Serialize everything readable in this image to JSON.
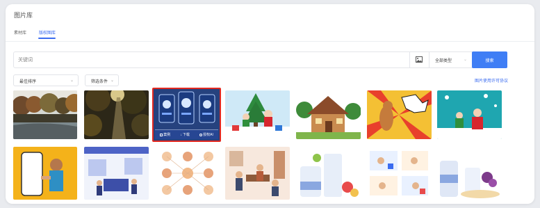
{
  "window": {
    "title": "图片库"
  },
  "tabs": [
    {
      "label": "素材库",
      "active": false
    },
    {
      "label": "版权图库",
      "active": true
    }
  ],
  "search": {
    "placeholder": "关键词",
    "image_search_icon": "image-icon",
    "type_select": {
      "value": "全部类型"
    },
    "button_label": "搜索"
  },
  "filters": {
    "sort": {
      "value": "最佳排序"
    },
    "filter": {
      "value": "筛选条件"
    },
    "agreement_link": "图片使用许可协议"
  },
  "selected_overlay": {
    "buttons": [
      {
        "label": "案例",
        "icon": "square-icon"
      },
      {
        "label": "下载",
        "icon": "download-icon"
      },
      {
        "label": "授权AI",
        "icon": "circle-icon"
      }
    ]
  },
  "gallery": {
    "row1": [
      {
        "subject": "autumn forest lake",
        "icon": "photo-icon"
      },
      {
        "subject": "sunlit forest road",
        "icon": "photo-icon"
      },
      {
        "subject": "three phone mockups",
        "icon": "photo-icon",
        "selected": true
      },
      {
        "subject": "christmas tree with santa and elf",
        "icon": "illustration-icon"
      },
      {
        "subject": "cartoon cabin in the woods",
        "icon": "illustration-icon"
      },
      {
        "subject": "comic bang kangaroo",
        "icon": "illustration-icon"
      },
      {
        "subject": "santa and elf in snow",
        "icon": "illustration-icon"
      }
    ],
    "row2": [
      {
        "subject": "woman holding phone mockup",
        "icon": "photo-icon"
      },
      {
        "subject": "office workers at desks",
        "icon": "illustration-icon"
      },
      {
        "subject": "icon grid of people and activities",
        "icon": "illustration-icon"
      },
      {
        "subject": "people meeting in office lounge",
        "icon": "illustration-icon"
      },
      {
        "subject": "milk bottles and fruit",
        "icon": "illustration-icon"
      },
      {
        "subject": "people in kitchen scenes",
        "icon": "illustration-icon"
      },
      {
        "subject": "milk products with grapes",
        "icon": "illustration-icon"
      }
    ]
  },
  "colors": {
    "accent": "#3f7ef5",
    "selection_border": "#e3281f",
    "background": "#e9ebef"
  }
}
